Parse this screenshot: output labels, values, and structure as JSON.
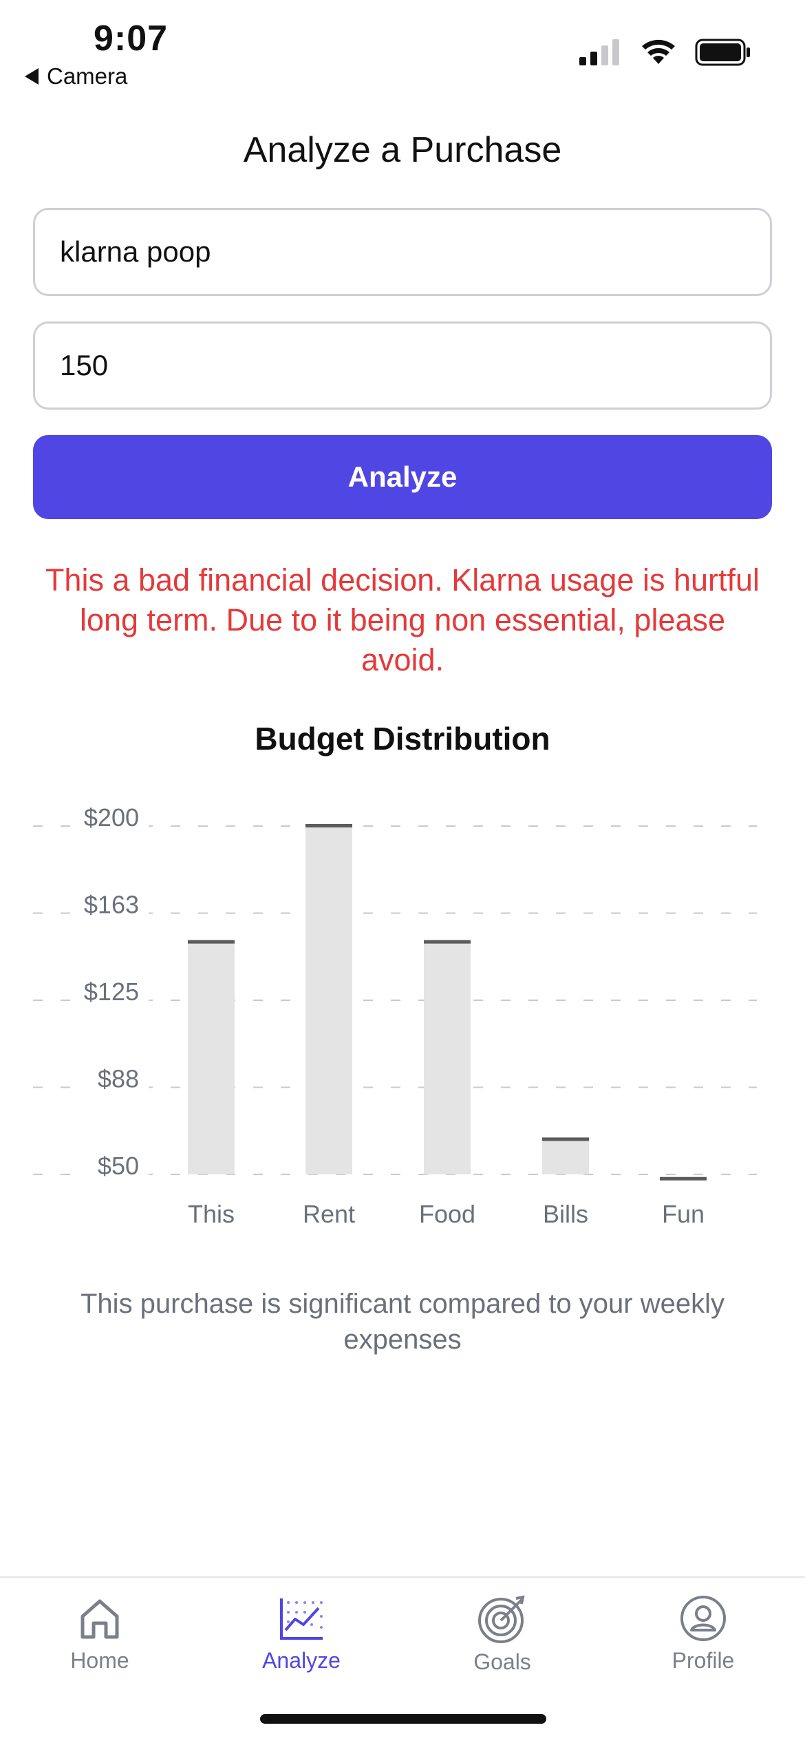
{
  "status_bar": {
    "time": "9:07",
    "back_label": "Camera",
    "back_icon": "triangle-left-icon",
    "signal_icon": "cellular-signal-icon",
    "wifi_icon": "wifi-icon",
    "battery_icon": "battery-icon"
  },
  "page": {
    "title": "Analyze a Purchase"
  },
  "form": {
    "item_value": "klarna poop",
    "amount_value": "150",
    "analyze_label": "Analyze"
  },
  "result": {
    "verdict": "This a bad financial decision. Klarna usage is hurtful long term. Due to it being non essential, please avoid.",
    "verdict_color": "#e5393a",
    "summary": "This purchase is significant compared to your weekly expenses"
  },
  "chart_data": {
    "type": "bar",
    "title": "Budget Distribution",
    "categories": [
      "This",
      "Rent",
      "Food",
      "Bills",
      "Fun"
    ],
    "values": [
      150,
      200,
      150,
      65,
      48
    ],
    "y_tick_labels": [
      "$200",
      "$163",
      "$125",
      "$88",
      "$50"
    ],
    "y_ticks": [
      200,
      162.5,
      125,
      87.5,
      50
    ],
    "ylim": [
      50,
      200
    ],
    "xlabel": "",
    "ylabel": "",
    "grid": "dashed horizontal",
    "bar_color": "#e4e4e4",
    "cap_color": "#5b5b5b"
  },
  "tabs": [
    {
      "label": "Home",
      "icon": "home-icon",
      "active": false
    },
    {
      "label": "Analyze",
      "icon": "chart-icon",
      "active": true
    },
    {
      "label": "Goals",
      "icon": "target-icon",
      "active": false
    },
    {
      "label": "Profile",
      "icon": "user-circle-icon",
      "active": false
    }
  ],
  "colors": {
    "accent": "#5046e4",
    "tab_inactive": "#7b7f8c"
  }
}
